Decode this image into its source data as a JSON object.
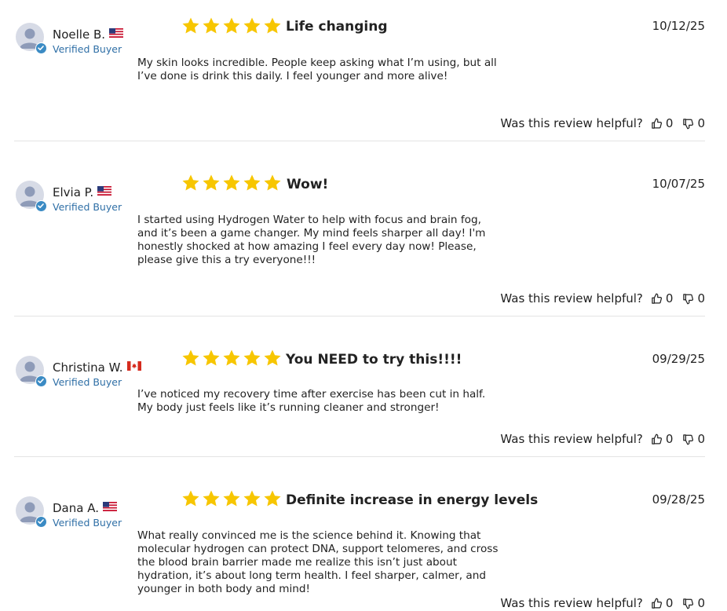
{
  "reviews": [
    {
      "author": "Noelle B.",
      "country_flag": "us-flag",
      "verified_label": "Verified Buyer",
      "rating": 5,
      "title": "Life changing",
      "date": "10/12/25",
      "body": "My skin looks incredible. People keep asking what I’m using, but all I’ve done is drink this daily. I feel younger and more alive!",
      "helpful_prompt": "Was this review helpful?",
      "upvotes": "0",
      "downvotes": "0"
    },
    {
      "author": "Elvia P.",
      "country_flag": "us-flag",
      "verified_label": "Verified Buyer",
      "rating": 5,
      "title": "Wow!",
      "date": "10/07/25",
      "body": "I started using Hydrogen Water to help with focus and brain fog, and it’s been a game changer. My mind feels sharper all day!  I'm honestly shocked at how amazing I feel every day now!  Please, please give this a try everyone!!!",
      "helpful_prompt": "Was this review helpful?",
      "upvotes": "0",
      "downvotes": "0"
    },
    {
      "author": "Christina W.",
      "country_flag": "canada-flag",
      "verified_label": "Verified Buyer",
      "rating": 5,
      "title": "You NEED to try this!!!!",
      "date": "09/29/25",
      "body": "I’ve noticed my recovery time after exercise has been cut in half. My body just feels like it’s running cleaner and stronger!",
      "helpful_prompt": "Was this review helpful?",
      "upvotes": "0",
      "downvotes": "0"
    },
    {
      "author": "Dana A.",
      "country_flag": "us-flag",
      "verified_label": "Verified Buyer",
      "rating": 5,
      "title": "Definite increase in energy levels",
      "date": "09/28/25",
      "body": "What really convinced me is the science behind it. Knowing that molecular hydrogen can protect DNA, support telomeres, and cross the blood brain barrier made me realize this isn’t just about hydration, it’s about long term health. I feel sharper, calmer, and younger in both body and mind!",
      "helpful_prompt": "Was this review helpful?",
      "upvotes": "0",
      "downvotes": "0"
    }
  ],
  "colors": {
    "star": "#f7c600",
    "verified_badge": "#3b8bc4",
    "verified_text": "#2f6fa6",
    "divider": "#e4e4e4"
  }
}
